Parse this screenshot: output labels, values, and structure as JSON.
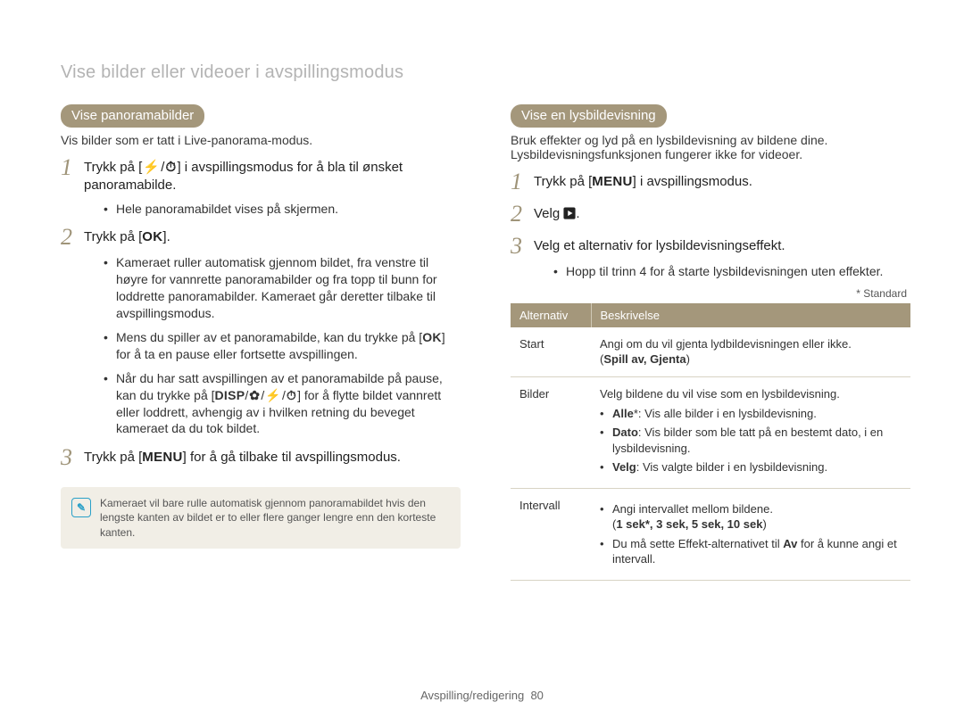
{
  "header": {
    "title": "Vise bilder eller videoer i avspillingsmodus"
  },
  "glyphs": {
    "flash": "⚡",
    "timer": "⏱",
    "ok": "OK",
    "menu": "MENU",
    "disp": "DISP",
    "flower": "✿",
    "play": "▶"
  },
  "left": {
    "section_title": "Vise panoramabilder",
    "lead": "Vis bilder som er tatt i Live-panorama-modus.",
    "step1a": "Trykk på [",
    "step1b": "] i avspillingsmodus for å bla til ønsket panoramabilde.",
    "step1_bullet": "Hele panoramabildet vises på skjermen.",
    "step2a": "Trykk på [",
    "step2b": "].",
    "step2_b1": "Kameraet ruller automatisk gjennom bildet, fra venstre til høyre for vannrette panoramabilder og fra topp til bunn for loddrette panoramabilder. Kameraet går deretter tilbake til avspillingsmodus.",
    "step2_b2a": "Mens du spiller av et panoramabilde, kan du trykke på [",
    "step2_b2b": "] for å ta en pause eller fortsette avspillingen.",
    "step2_b3a": "Når du har satt avspillingen av et panoramabilde på pause, kan du trykke på [",
    "step2_b3b": "] for å flytte bildet vannrett eller loddrett, avhengig av i hvilken retning du beveget kameraet da du tok bildet.",
    "step3a": "Trykk på [",
    "step3b": "] for å gå tilbake til avspillingsmodus.",
    "note": "Kameraet vil bare rulle automatisk gjennom panoramabildet hvis den lengste kanten av bildet er to eller flere ganger lengre enn den korteste kanten."
  },
  "right": {
    "section_title": "Vise en lysbildevisning",
    "lead": "Bruk effekter og lyd på en lysbildevisning av bildene dine. Lysbildevisningsfunksjonen fungerer ikke for videoer.",
    "step1a": "Trykk på [",
    "step1b": "] i avspillingsmodus.",
    "step2a": "Velg ",
    "step2b": ".",
    "step3": "Velg et alternativ for lysbildevisningseffekt.",
    "step3_bullet": "Hopp til trinn 4 for å starte lysbildevisningen uten effekter.",
    "footnote": "* Standard",
    "table": {
      "head_option": "Alternativ",
      "head_desc": "Beskrivelse",
      "rows": [
        {
          "opt": "Start",
          "line1": "Angi om du vil gjenta lydbildevisningen eller ikke.",
          "line2_open": "(",
          "line2_values": "Spill av, Gjenta",
          "line2_close": ")"
        },
        {
          "opt": "Bilder",
          "line1": "Velg bildene du vil vise som en lysbildevisning.",
          "b1a": "Alle",
          "b1b": "*: Vis alle bilder i en lysbildevisning.",
          "b2a": "Dato",
          "b2b": ": Vis bilder som ble tatt på en bestemt dato, i en lysbildevisning.",
          "b3a": "Velg",
          "b3b": ": Vis valgte bilder i en lysbildevisning."
        },
        {
          "opt": "Intervall",
          "b1": "Angi intervallet mellom bildene.",
          "values_open": "(",
          "values": "1 sek*, 3 sek, 5 sek, 10 sek",
          "values_close": ")",
          "b2a": "Du må sette Effekt-alternativet til ",
          "b2b": "Av",
          "b2c": " for å kunne angi et intervall."
        }
      ]
    }
  },
  "footer": {
    "section": "Avspilling/redigering",
    "page": "80"
  }
}
